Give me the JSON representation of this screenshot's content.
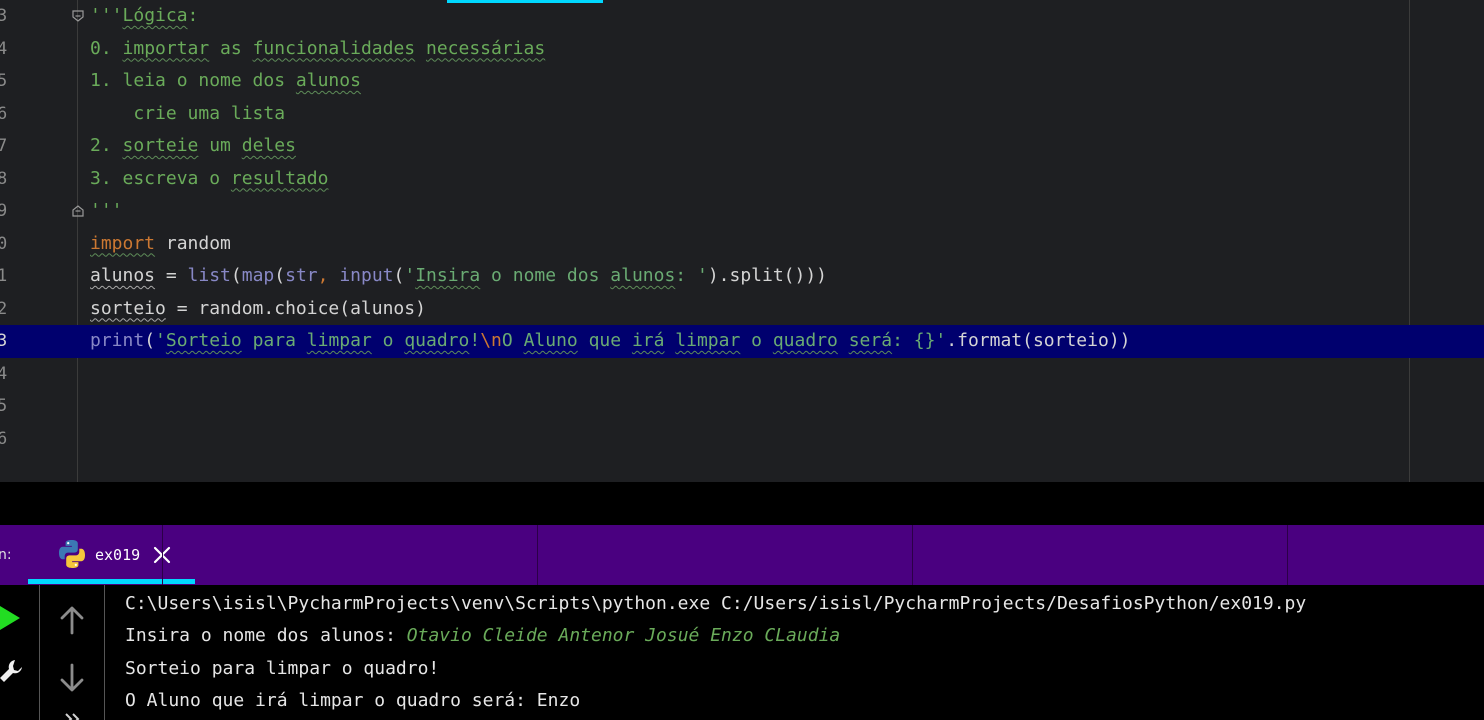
{
  "editor": {
    "lines": [
      {
        "num": "3",
        "segments": [
          {
            "t": "'''",
            "c": "c-doc"
          },
          {
            "t": "Lógica",
            "c": "c-doc wavy"
          },
          {
            "t": ":",
            "c": "c-doc"
          }
        ],
        "fold": true
      },
      {
        "num": "4",
        "segments": [
          {
            "t": "0. ",
            "c": "c-doc"
          },
          {
            "t": "importar",
            "c": "c-doc wavy"
          },
          {
            "t": " as ",
            "c": "c-doc"
          },
          {
            "t": "funcionalidades",
            "c": "c-doc wavy"
          },
          {
            "t": " ",
            "c": "c-doc"
          },
          {
            "t": "necessárias",
            "c": "c-doc wavy"
          }
        ]
      },
      {
        "num": "5",
        "segments": [
          {
            "t": "1. leia o nome dos ",
            "c": "c-doc"
          },
          {
            "t": "alunos",
            "c": "c-doc wavy"
          }
        ]
      },
      {
        "num": "6",
        "segments": [
          {
            "t": "    crie uma lista",
            "c": "c-doc"
          }
        ]
      },
      {
        "num": "7",
        "segments": [
          {
            "t": "2. ",
            "c": "c-doc"
          },
          {
            "t": "sorteie",
            "c": "c-doc wavy"
          },
          {
            "t": " um ",
            "c": "c-doc"
          },
          {
            "t": "deles",
            "c": "c-doc wavy"
          }
        ]
      },
      {
        "num": "8",
        "segments": [
          {
            "t": "3. escreva o ",
            "c": "c-doc"
          },
          {
            "t": "resultado",
            "c": "c-doc wavy"
          }
        ]
      },
      {
        "num": "9",
        "segments": [
          {
            "t": "'''",
            "c": "c-doc"
          }
        ],
        "fold": true
      },
      {
        "num": "0",
        "segments": [
          {
            "t": "import",
            "c": "c-key wavy"
          },
          {
            "t": " random",
            "c": "c-id"
          }
        ]
      },
      {
        "num": "1",
        "segments": [
          {
            "t": "alunos",
            "c": "c-id wavy-w"
          },
          {
            "t": " = ",
            "c": "c-id"
          },
          {
            "t": "list",
            "c": "c-bi"
          },
          {
            "t": "(",
            "c": "c-id"
          },
          {
            "t": "map",
            "c": "c-bi"
          },
          {
            "t": "(",
            "c": "c-id"
          },
          {
            "t": "str",
            "c": "c-bi"
          },
          {
            "t": ", ",
            "c": "c-key"
          },
          {
            "t": "input",
            "c": "c-bi"
          },
          {
            "t": "(",
            "c": "c-id"
          },
          {
            "t": "'",
            "c": "c-str"
          },
          {
            "t": "Insira",
            "c": "c-str wavy"
          },
          {
            "t": " o nome dos ",
            "c": "c-str"
          },
          {
            "t": "alunos",
            "c": "c-str wavy"
          },
          {
            "t": ": '",
            "c": "c-str"
          },
          {
            "t": ").split()))",
            "c": "c-id"
          }
        ]
      },
      {
        "num": "2",
        "segments": [
          {
            "t": "sorteio",
            "c": "c-id wavy-w"
          },
          {
            "t": " = random.choice(alunos)",
            "c": "c-id"
          }
        ]
      },
      {
        "num": "3",
        "current": true,
        "segments": [
          {
            "t": "print",
            "c": "c-bi"
          },
          {
            "t": "(",
            "c": "c-id"
          },
          {
            "t": "'",
            "c": "c-str"
          },
          {
            "t": "Sorteio",
            "c": "c-str wavy"
          },
          {
            "t": " para ",
            "c": "c-str"
          },
          {
            "t": "limpar",
            "c": "c-str wavy"
          },
          {
            "t": " o ",
            "c": "c-str"
          },
          {
            "t": "quadro",
            "c": "c-str wavy"
          },
          {
            "t": "!",
            "c": "c-str"
          },
          {
            "t": "\\n",
            "c": "c-esc"
          },
          {
            "t": "O ",
            "c": "c-str"
          },
          {
            "t": "Aluno",
            "c": "c-str wavy"
          },
          {
            "t": " que ",
            "c": "c-str"
          },
          {
            "t": "irá",
            "c": "c-str wavy"
          },
          {
            "t": " ",
            "c": "c-str"
          },
          {
            "t": "limpar",
            "c": "c-str wavy"
          },
          {
            "t": " o ",
            "c": "c-str"
          },
          {
            "t": "quadro",
            "c": "c-str wavy"
          },
          {
            "t": " ",
            "c": "c-str"
          },
          {
            "t": "será",
            "c": "c-str wavy"
          },
          {
            "t": ": {}'",
            "c": "c-str"
          },
          {
            "t": ".format(sorteio))",
            "c": "c-id"
          }
        ]
      },
      {
        "num": "4",
        "segments": []
      },
      {
        "num": "5",
        "segments": []
      },
      {
        "num": "6",
        "segments": []
      }
    ]
  },
  "run_window": {
    "label": "n:",
    "tab_label": "ex019",
    "accent_color": "#4a0080",
    "tab_underline_color": "#00d8ff"
  },
  "console": {
    "command": "C:\\Users\\isisl\\PycharmProjects\\venv\\Scripts\\python.exe C:/Users/isisl/PycharmProjects/DesafiosPython/ex019.py",
    "prompt": "Insira o nome dos alunos: ",
    "user_input": "Otavio Cleide Antenor Josué Enzo CLaudia",
    "output_line_1": "Sorteio para limpar o quadro!",
    "output_line_2": "O Aluno que irá limpar o quadro será: Enzo"
  }
}
